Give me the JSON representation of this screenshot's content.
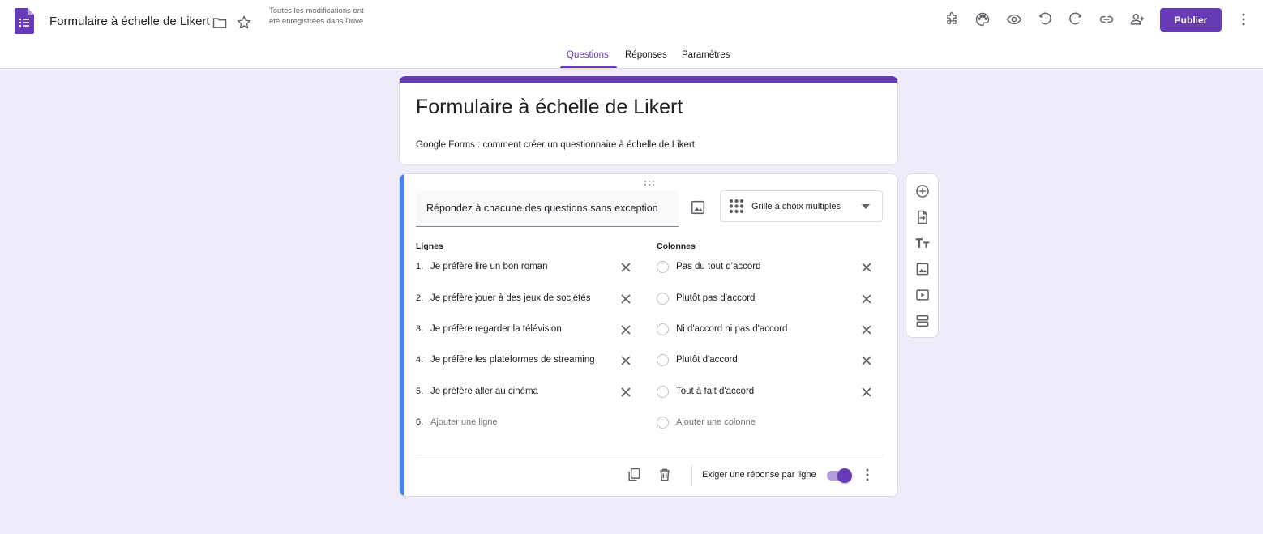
{
  "header": {
    "doc_title": "Formulaire à échelle de Likert",
    "save_status": "Toutes les modifications ont été enregistrées dans Drive",
    "publish_label": "Publier",
    "icons": [
      "addon-icon",
      "palette-icon",
      "preview-icon",
      "undo-icon",
      "redo-icon",
      "link-icon",
      "add-collaborator-icon",
      "more-vert-icon"
    ]
  },
  "tabs": [
    {
      "label": "Questions",
      "active": true
    },
    {
      "label": "Réponses",
      "active": false
    },
    {
      "label": "Paramètres",
      "active": false
    }
  ],
  "form": {
    "title": "Formulaire à échelle de Likert",
    "description": "Google Forms : comment créer un questionnaire à échelle de Likert"
  },
  "question": {
    "title": "Répondez à chacune des questions sans exception",
    "type_label": "Grille à choix multiples",
    "rows_heading": "Lignes",
    "columns_heading": "Colonnes",
    "rows": [
      {
        "num": "1.",
        "label": "Je préfère lire un bon roman"
      },
      {
        "num": "2.",
        "label": "Je préfère jouer à des jeux de sociétés"
      },
      {
        "num": "3.",
        "label": "Je préfère regarder la télévision"
      },
      {
        "num": "4.",
        "label": "Je préfère les plateformes de streaming"
      },
      {
        "num": "5.",
        "label": "Je préfère aller au cinéma"
      }
    ],
    "add_row": {
      "num": "6.",
      "label": "Ajouter une ligne"
    },
    "columns": [
      "Pas du tout d'accord",
      "Plutôt pas d'accord",
      "Ni d'accord ni pas d'accord",
      "Plutôt d'accord",
      "Tout à fait d'accord"
    ],
    "add_column": "Ajouter une colonne",
    "required_label": "Exiger une réponse par ligne",
    "required_on": true
  },
  "colors": {
    "accent": "#673ab7",
    "focus_bar": "#4285f4",
    "background": "#f0ebf8"
  }
}
